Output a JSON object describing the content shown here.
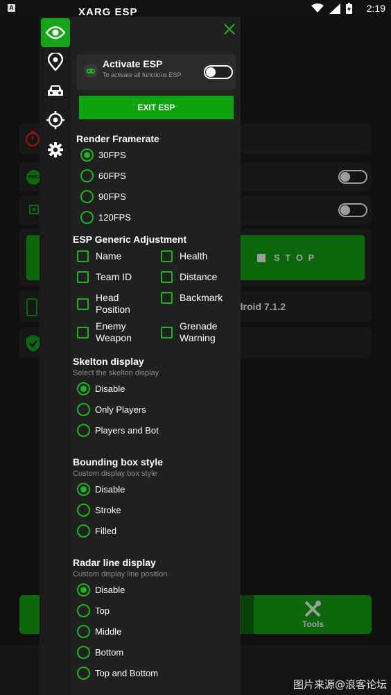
{
  "status_bar": {
    "time": "2:19",
    "badge": "A"
  },
  "background_app": {
    "stop_label": "S T O P",
    "android_version": "droid 7.1.2",
    "tools_label": "Tools",
    "rec_label": "REC"
  },
  "panel": {
    "title": "XARG ESP",
    "activate": {
      "title": "Activate ESP",
      "subtitle": "To activate all functions ESP"
    },
    "exit_label": "EXIT ESP",
    "render_framerate": {
      "heading": "Render Framerate",
      "options": [
        "30FPS",
        "60FPS",
        "90FPS",
        "120FPS"
      ],
      "selected": "30FPS"
    },
    "generic_adjustment": {
      "heading": "ESP Generic Adjustment",
      "options": [
        "Name",
        "Health",
        "Team ID",
        "Distance",
        "Head\nPosition",
        "Backmark",
        "Enemy\nWeapon",
        "Grenade\nWarning"
      ]
    },
    "skelton": {
      "heading": "Skelton display",
      "sub": "Select the skelton display",
      "options": [
        "Disable",
        "Only Players",
        "Players and Bot"
      ],
      "selected": "Disable"
    },
    "bounding_box": {
      "heading": "Bounding box style",
      "sub": "Custom display box style",
      "options": [
        "Disable",
        "Stroke",
        "Filled"
      ],
      "selected": "Disable"
    },
    "radar_line": {
      "heading": "Radar line display",
      "sub": "Custom display line position",
      "options": [
        "Disable",
        "Top",
        "Middle",
        "Bottom",
        "Top and Bottom"
      ],
      "selected": "Disable"
    }
  },
  "watermark": "图片来源@浪客论坛",
  "colors": {
    "accent": "#1db41d",
    "button_green": "#0fa30f",
    "panel_bg": "#202020"
  }
}
